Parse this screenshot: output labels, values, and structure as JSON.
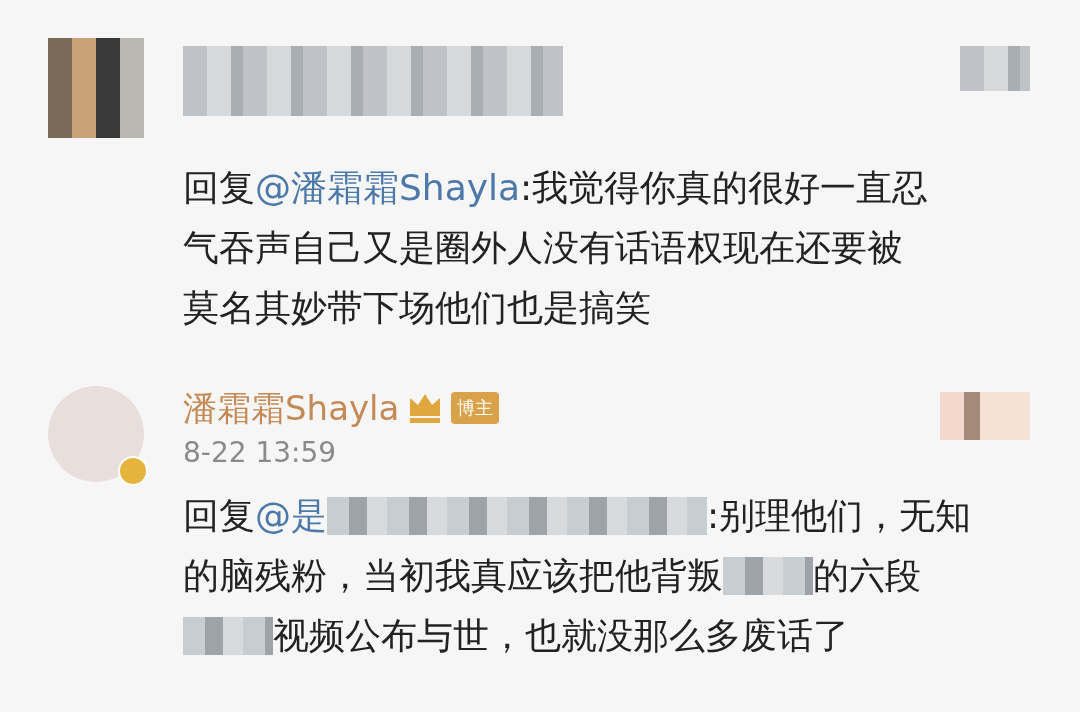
{
  "comments": [
    {
      "avatar": {
        "kind": "pixelated"
      },
      "header": {
        "kind": "pixelated"
      },
      "reply_lines": [
        [
          {
            "kind": "text",
            "text": "回复"
          },
          {
            "kind": "mention",
            "text": "@潘霜霜Shayla"
          },
          {
            "kind": "text",
            "text": ":我觉得你真的很好一直忍"
          }
        ],
        [
          {
            "kind": "text",
            "text": "气吞声自己又是圈外人没有话语权现在还要被"
          }
        ],
        [
          {
            "kind": "text",
            "text": "莫名其妙带下场他们也是搞笑"
          }
        ]
      ]
    },
    {
      "avatar": {
        "kind": "photo"
      },
      "verified": true,
      "header": {
        "kind": "named"
      },
      "name": "潘霜霜Shayla",
      "badge": "博主",
      "time": "8-22 13:59",
      "reply_lines": [
        [
          {
            "kind": "text",
            "text": "回复"
          },
          {
            "kind": "mention",
            "text": "@是"
          },
          {
            "kind": "blur-wide"
          },
          {
            "kind": "text",
            "text": ":别理他们，无知"
          }
        ],
        [
          {
            "kind": "text",
            "text": "的脑残粉，当初我真应该把他背叛"
          },
          {
            "kind": "blur"
          },
          {
            "kind": "text",
            "text": "的六段"
          }
        ],
        [
          {
            "kind": "blur"
          },
          {
            "kind": "text",
            "text": "视频公布与世，也就没那么多废话了"
          }
        ]
      ]
    }
  ]
}
